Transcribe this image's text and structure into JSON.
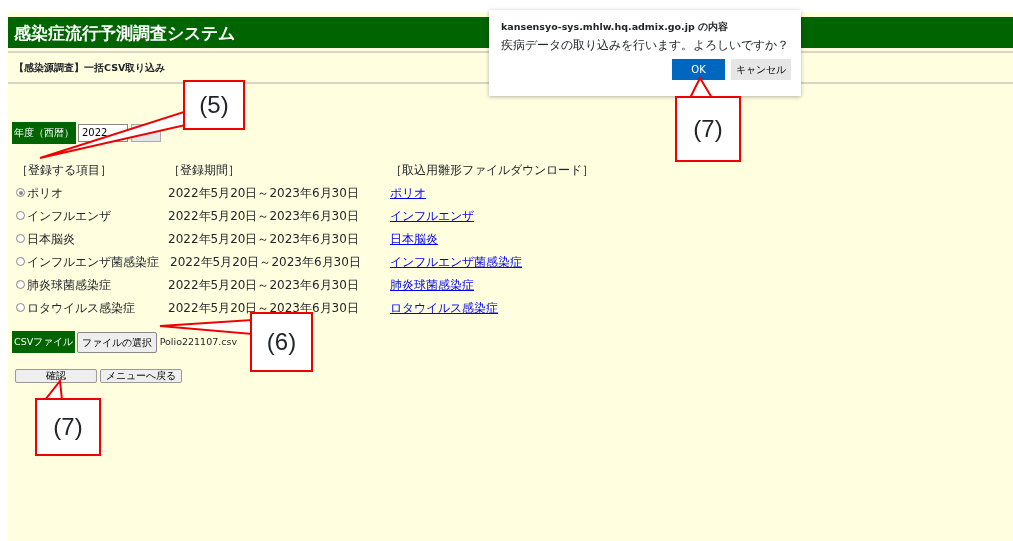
{
  "header": {
    "title": "感染症流行予測調査システム"
  },
  "page_title": "【感染源調査】一括CSV取り込み",
  "year": {
    "label": "年度（西暦）",
    "value": "2022"
  },
  "columns": [
    "［登録する項目］",
    "［登録期間］",
    "［取込用雛形ファイルダウンロード］"
  ],
  "items": [
    {
      "label": "ポリオ",
      "period": "2022年5月20日～2023年6月30日",
      "link": "ポリオ",
      "selected": true
    },
    {
      "label": "インフルエンザ",
      "period": "2022年5月20日～2023年6月30日",
      "link": "インフルエンザ",
      "selected": false
    },
    {
      "label": "日本脳炎",
      "period": "2022年5月20日～2023年6月30日",
      "link": "日本脳炎",
      "selected": false
    },
    {
      "label": "インフルエンザ菌感染症",
      "period": "2022年5月20日～2023年6月30日",
      "link": "インフルエンザ菌感染症",
      "selected": false
    },
    {
      "label": "肺炎球菌感染症",
      "period": "2022年5月20日～2023年6月30日",
      "link": "肺炎球菌感染症",
      "selected": false
    },
    {
      "label": "ロタウイルス感染症",
      "period": "2022年5月20日～2023年6月30日",
      "link": "ロタウイルス感染症",
      "selected": false
    }
  ],
  "csv": {
    "label": "CSVファイル",
    "button": "ファイルの選択",
    "file": "Polio221107.csv"
  },
  "buttons": [
    "確認",
    "メニューへ戻る"
  ],
  "dialog": {
    "title": "kansensyo-sys.mhlw.hq.admix.go.jp の内容",
    "message": "疾病データの取り込みを行います。よろしいですか？",
    "ok": "OK",
    "cancel": "キャンセル"
  },
  "callouts": [
    {
      "label": "(5)"
    },
    {
      "label": "(6)"
    },
    {
      "label": "(7)"
    },
    {
      "label": "(7)"
    }
  ]
}
